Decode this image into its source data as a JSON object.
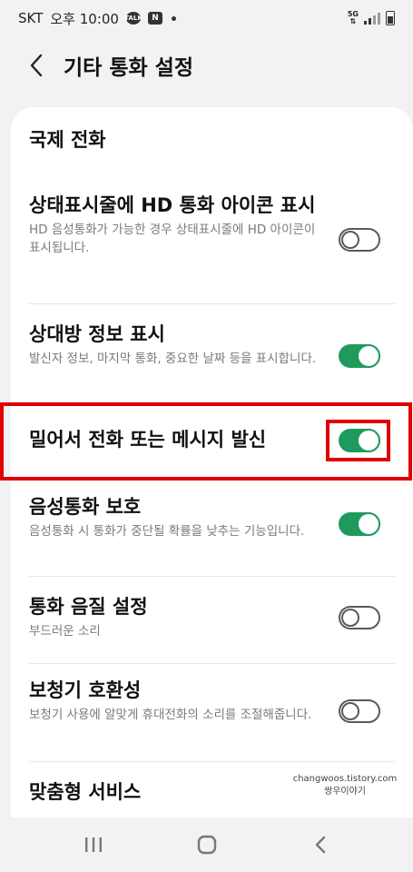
{
  "status_bar": {
    "carrier": "SKT",
    "time": "오후 10:00",
    "talk_icon_label": "TALK",
    "n_icon_label": "N",
    "network_top": "5G",
    "network_bottom": "⇅",
    "icons": [
      "kakaotalk-icon",
      "naver-icon",
      "dot-icon",
      "signal-icon",
      "battery-icon"
    ]
  },
  "header": {
    "title": "기타 통화 설정",
    "back_icon": "chevron-left-icon"
  },
  "settings": {
    "items": [
      {
        "title": "국제 전화"
      },
      {
        "title": "상태표시줄에 HD 통화 아이콘 표시",
        "subtitle": "HD 음성통화가 가능한 경우 상태표시줄에 HD 아이콘이 표시됩니다.",
        "toggle": "off"
      },
      {
        "title": "상대방 정보 표시",
        "subtitle": "발신자 정보, 마지막 통화, 중요한 날짜 등을 표시합니다.",
        "toggle": "on"
      },
      {
        "title": "밀어서 전화 또는 메시지 발신",
        "toggle": "on"
      },
      {
        "title": "음성통화 보호",
        "subtitle": "음성통화 시 통화가 중단될 확률을 낮추는 기능입니다.",
        "toggle": "on"
      },
      {
        "title": "통화 음질 설정",
        "subtitle": "부드러운 소리",
        "toggle": "off"
      },
      {
        "title": "보청기 호환성",
        "subtitle": "보청기 사용에 알맞게 휴대전화의 소리를 조절해줍니다.",
        "toggle": "off"
      },
      {
        "title": "맞춤형 서비스"
      }
    ]
  },
  "watermark": {
    "line1": "changwoos.tistory.com",
    "line2": "쌍우이야기"
  },
  "nav": {
    "icons": [
      "recent-apps-icon",
      "home-icon",
      "back-icon"
    ]
  },
  "colors": {
    "toggle_on": "#1f9a5d",
    "highlight": "#e00000",
    "background": "#f2f2f2"
  }
}
